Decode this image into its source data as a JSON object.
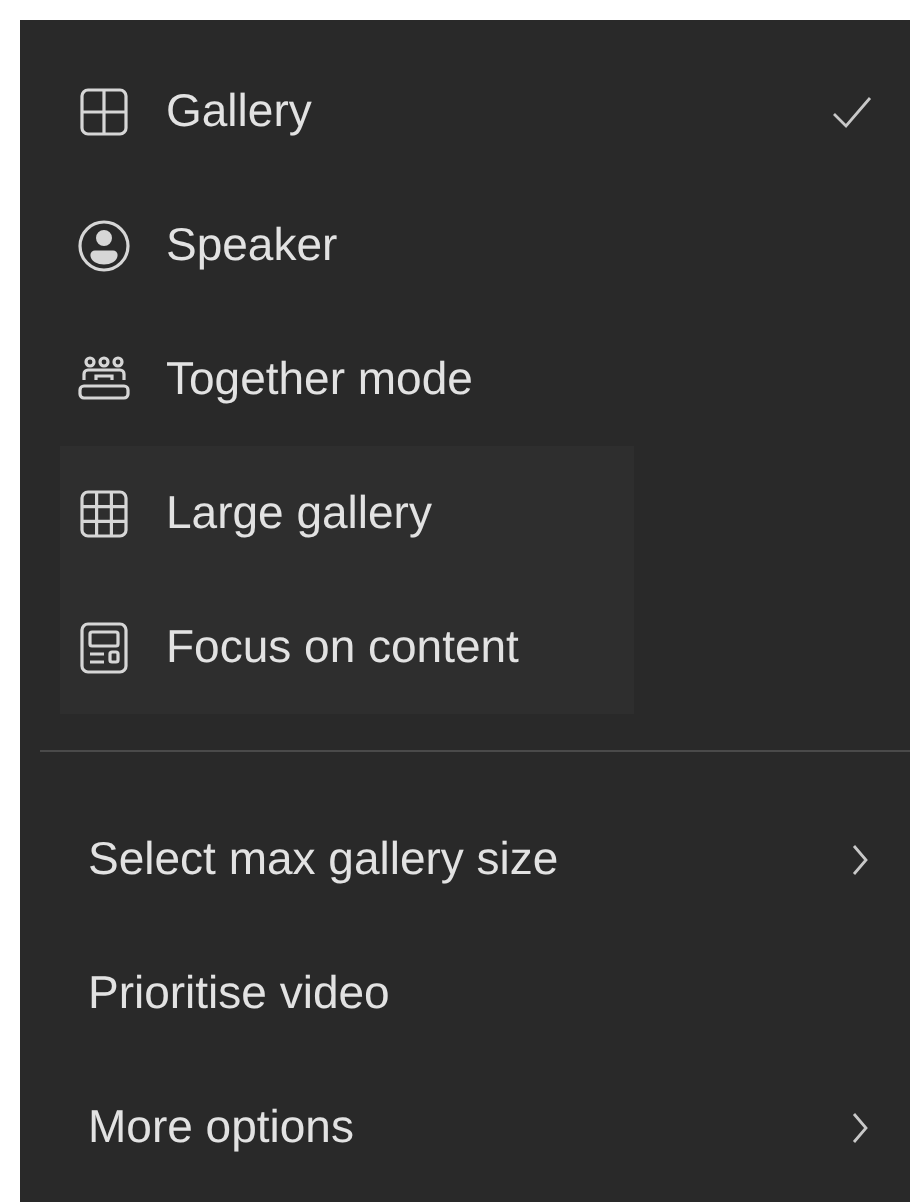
{
  "view_options": [
    {
      "kind": "grid",
      "label": "Gallery",
      "selected": true,
      "highlighted": false
    },
    {
      "kind": "person",
      "label": "Speaker",
      "selected": false,
      "highlighted": false
    },
    {
      "kind": "group",
      "label": "Together mode",
      "selected": false,
      "highlighted": false
    },
    {
      "kind": "large-grid",
      "label": "Large gallery",
      "selected": false,
      "highlighted": true
    },
    {
      "kind": "content",
      "label": "Focus on content",
      "selected": false,
      "highlighted": true
    }
  ],
  "more_items": [
    {
      "label": "Select max gallery size",
      "submenu": true
    },
    {
      "label": "Prioritise video",
      "submenu": false
    },
    {
      "label": "More options",
      "submenu": true
    }
  ]
}
